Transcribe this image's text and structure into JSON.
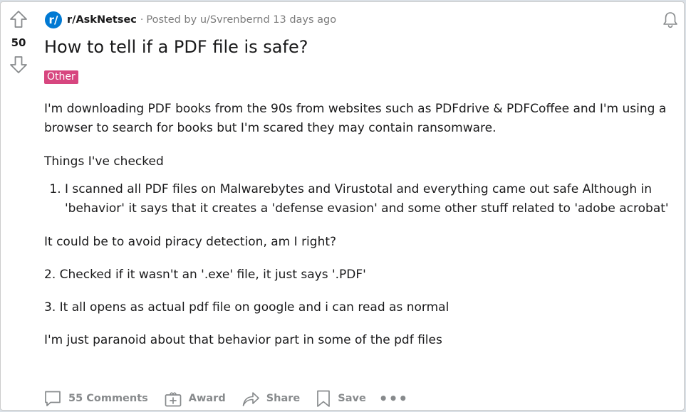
{
  "post": {
    "score": "50",
    "subreddit_icon_text": "r/",
    "subreddit": "r/AskNetsec",
    "separator": "·",
    "posted_by": "Posted by u/Svrenbernd 13 days ago",
    "title": "How to tell if a PDF file is safe?",
    "flair": "Other",
    "flair_color": "#d7467f",
    "body": {
      "p1": "I'm downloading PDF books from the 90s from websites such as PDFdrive & PDFCoffee and I'm using a browser to search for books but I'm scared they may contain ransomware.",
      "p2": "Things I've checked",
      "list": [
        "I scanned all PDF files on Malwarebytes and Virustotal and everything came out safe Although in 'behavior' it says that it creates a 'defense evasion' and some other stuff related to 'adobe acrobat'"
      ],
      "p3": "It could be to avoid piracy detection, am I right?",
      "p4": "2. Checked if it wasn't an '.exe' file, it just says '.PDF'",
      "p5": "3. It all opens as actual pdf file on google and i can read as normal",
      "p6": "I'm just paranoid about that behavior part in some of the pdf files"
    }
  },
  "actions": {
    "comments": "55 Comments",
    "award": "Award",
    "share": "Share",
    "save": "Save",
    "more": "•••"
  },
  "icons": {
    "upvote": "arrow-up-icon",
    "downvote": "arrow-down-icon",
    "notify": "bell-icon",
    "comments": "comment-bubble-icon",
    "award": "gift-icon",
    "share": "share-arrow-icon",
    "save": "bookmark-icon",
    "more": "ellipsis-icon"
  }
}
